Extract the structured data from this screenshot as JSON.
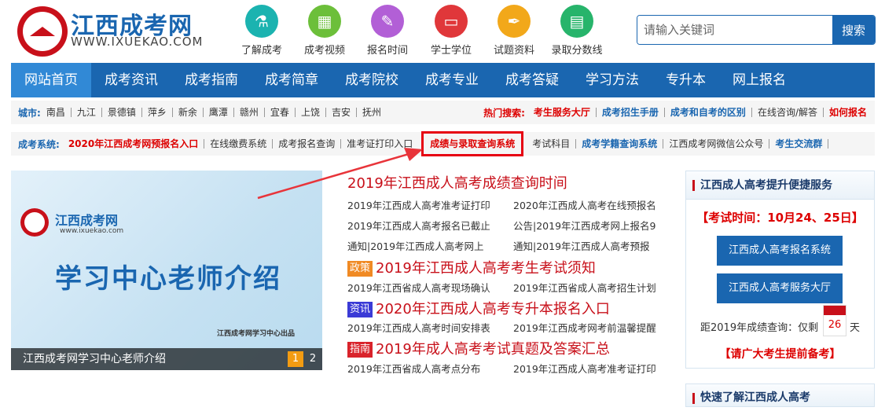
{
  "header": {
    "title": "江西成考网",
    "url": "WWW.IXUEKAO.COM",
    "quick_links": [
      {
        "label": "了解成考",
        "color": "#1bb3b0",
        "icon": "flask-icon",
        "glyph": "⚗"
      },
      {
        "label": "成考视频",
        "color": "#6cbf3a",
        "icon": "building-icon",
        "glyph": "▦"
      },
      {
        "label": "报名时间",
        "color": "#b25fd6",
        "icon": "tools-icon",
        "glyph": "✎"
      },
      {
        "label": "学士学位",
        "color": "#e0373a",
        "icon": "laptop-icon",
        "glyph": "▭"
      },
      {
        "label": "试题资料",
        "color": "#f2a81a",
        "icon": "pen-icon",
        "glyph": "✒"
      },
      {
        "label": "录取分数线",
        "color": "#27b46b",
        "icon": "clipboard-icon",
        "glyph": "▤"
      }
    ],
    "search": {
      "placeholder": "请输入关键词",
      "button": "搜索"
    }
  },
  "nav": [
    "网站首页",
    "成考资讯",
    "成考指南",
    "成考简章",
    "成考院校",
    "成考专业",
    "成考答疑",
    "学习方法",
    "专升本",
    "网上报名"
  ],
  "cities": {
    "label": "城市:",
    "items": [
      "南昌",
      "九江",
      "景德镇",
      "萍乡",
      "新余",
      "鹰潭",
      "赣州",
      "宜春",
      "上饶",
      "吉安",
      "抚州"
    ],
    "hot_label": "热门搜索:",
    "hot": [
      "考生服务大厅",
      "成考招生手册",
      "成考和自考的区别",
      "在线咨询/解答",
      "如何报名"
    ]
  },
  "systems": {
    "label": "成考系统:",
    "items": [
      "2020年江西成考网预报名入口",
      "在线缴费系统",
      "成考报名查询",
      "准考证打印入口",
      "成绩与录取查询系统",
      "考试科目",
      "成考学籍查询系统",
      "江西成考网微信公众号",
      "考生交流群"
    ]
  },
  "banner": {
    "logo_name": "江西成考网",
    "logo_url": "www.ixuekao.com",
    "title": "学习中心老师介绍",
    "sub": "江西成考网学习中心出品",
    "caption": "江西成考网学习中心老师介绍",
    "pages": [
      "1",
      "2"
    ]
  },
  "news": {
    "headline": "2019年江西成人高考成绩查询时间",
    "group1": [
      "2019年江西成人高考准考证打印",
      "2020年江西成人高考在线预报名",
      "2019年江西成人高考报名已截止",
      "公告|2019年江西成考网上报名9",
      "通知|2019年江西成人高考网上",
      "通知|2019年江西成人高考预报"
    ],
    "h2_tag": "政策",
    "h2": "2019年江西成人高考考生考试须知",
    "group2": [
      "2019年江西省成人高考现场确认",
      "2019年江西省成人高考招生计划"
    ],
    "h3_tag": "资讯",
    "h3": "2020年江西成人高考专升本报名入口",
    "group3": [
      "2019年江西成人高考时间安排表",
      "2019年江西成考网考前温馨提醒"
    ],
    "h4_tag": "指南",
    "h4": "2019年成人高考考试真题及答案汇总",
    "group4": [
      "2019年江西省成人高考点分布",
      "2019年江西成人高考准考证打印"
    ]
  },
  "sidebar": {
    "title": "江西成人高考提升便捷服务",
    "exam_time": "【考试时间：10月24、25日】",
    "btn1": "江西成人高考报名系统",
    "btn2": "江西成人高考服务大厅",
    "countdown_label": "距2019年成绩查询：仅剩",
    "countdown_days": "26",
    "days_unit": "天",
    "remind": "【请广大考生提前备考】",
    "title2": "快速了解江西成人高考"
  }
}
